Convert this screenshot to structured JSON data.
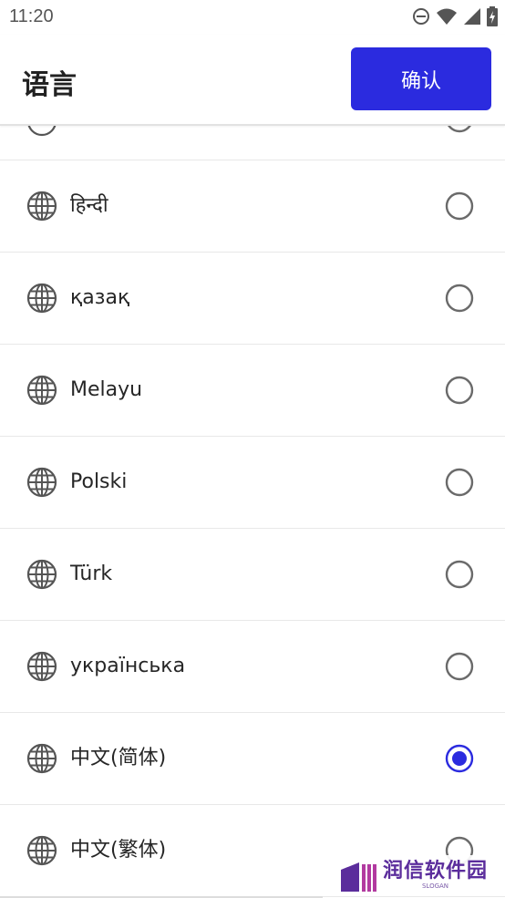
{
  "status_bar": {
    "time": "11:20"
  },
  "header": {
    "title": "语言",
    "confirm_label": "确认"
  },
  "colors": {
    "accent": "#2b2bdf",
    "radio_unselected": "#6a6a6a",
    "globe": "#555555"
  },
  "languages": [
    {
      "label": "हिन्दी",
      "selected": false
    },
    {
      "label": "қазақ",
      "selected": false
    },
    {
      "label": "Melayu",
      "selected": false
    },
    {
      "label": "Polski",
      "selected": false
    },
    {
      "label": "Türk",
      "selected": false
    },
    {
      "label": "українська",
      "selected": false
    },
    {
      "label": "中文(简体)",
      "selected": true
    },
    {
      "label": "中文(繁体)",
      "selected": false
    }
  ],
  "watermark": {
    "text": "润信软件园",
    "sub": "SLOGAN"
  }
}
